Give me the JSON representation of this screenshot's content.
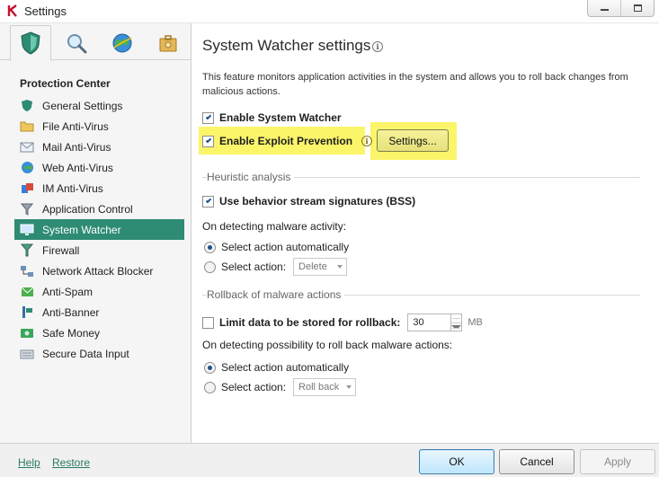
{
  "window": {
    "title": "Settings"
  },
  "colors": {
    "accent": "#2e8b74",
    "highlight": "#fbf56a",
    "link": "#2b7a66"
  },
  "tabs": [
    {
      "icon": "shield-icon",
      "active": true
    },
    {
      "icon": "magnifier-icon",
      "active": false
    },
    {
      "icon": "globe-icon",
      "active": false
    },
    {
      "icon": "toolbox-icon",
      "active": false
    }
  ],
  "sidebar": {
    "section_title": "Protection Center",
    "items": [
      {
        "label": "General Settings",
        "icon": "shield-small-icon"
      },
      {
        "label": "File Anti-Virus",
        "icon": "folder-icon"
      },
      {
        "label": "Mail Anti-Virus",
        "icon": "envelope-icon"
      },
      {
        "label": "Web Anti-Virus",
        "icon": "globe-small-icon"
      },
      {
        "label": "IM Anti-Virus",
        "icon": "chat-icon"
      },
      {
        "label": "Application Control",
        "icon": "funnel-icon"
      },
      {
        "label": "System Watcher",
        "icon": "monitor-icon",
        "active": true
      },
      {
        "label": "Firewall",
        "icon": "firewall-icon"
      },
      {
        "label": "Network Attack Blocker",
        "icon": "network-icon"
      },
      {
        "label": "Anti-Spam",
        "icon": "antispam-icon"
      },
      {
        "label": "Anti-Banner",
        "icon": "banner-icon"
      },
      {
        "label": "Safe Money",
        "icon": "money-icon"
      },
      {
        "label": "Secure Data Input",
        "icon": "keyboard-icon"
      }
    ]
  },
  "main": {
    "title": "System Watcher settings",
    "description": "This feature monitors application activities in the system and allows you to roll back changes from malicious actions.",
    "enable_system_watcher": {
      "label": "Enable System Watcher",
      "checked": true
    },
    "enable_exploit_prevention": {
      "label": "Enable Exploit Prevention",
      "checked": true
    },
    "settings_button": "Settings...",
    "heuristic": {
      "group_label": "Heuristic analysis",
      "bss": {
        "label": "Use behavior stream signatures (BSS)",
        "checked": true
      },
      "on_detect_label": "On detecting malware activity:",
      "radio_auto": "Select action automatically",
      "radio_manual": "Select action:",
      "action_value": "Delete"
    },
    "rollback": {
      "group_label": "Rollback of malware actions",
      "limit": {
        "label": "Limit data to be stored for rollback:",
        "checked": false,
        "value": "30",
        "unit": "MB"
      },
      "on_detect_label": "On detecting possibility to roll back malware actions:",
      "radio_auto": "Select action automatically",
      "radio_manual": "Select action:",
      "action_value": "Roll back"
    }
  },
  "footer": {
    "help": "Help",
    "restore": "Restore",
    "ok": "OK",
    "cancel": "Cancel",
    "apply": "Apply"
  }
}
